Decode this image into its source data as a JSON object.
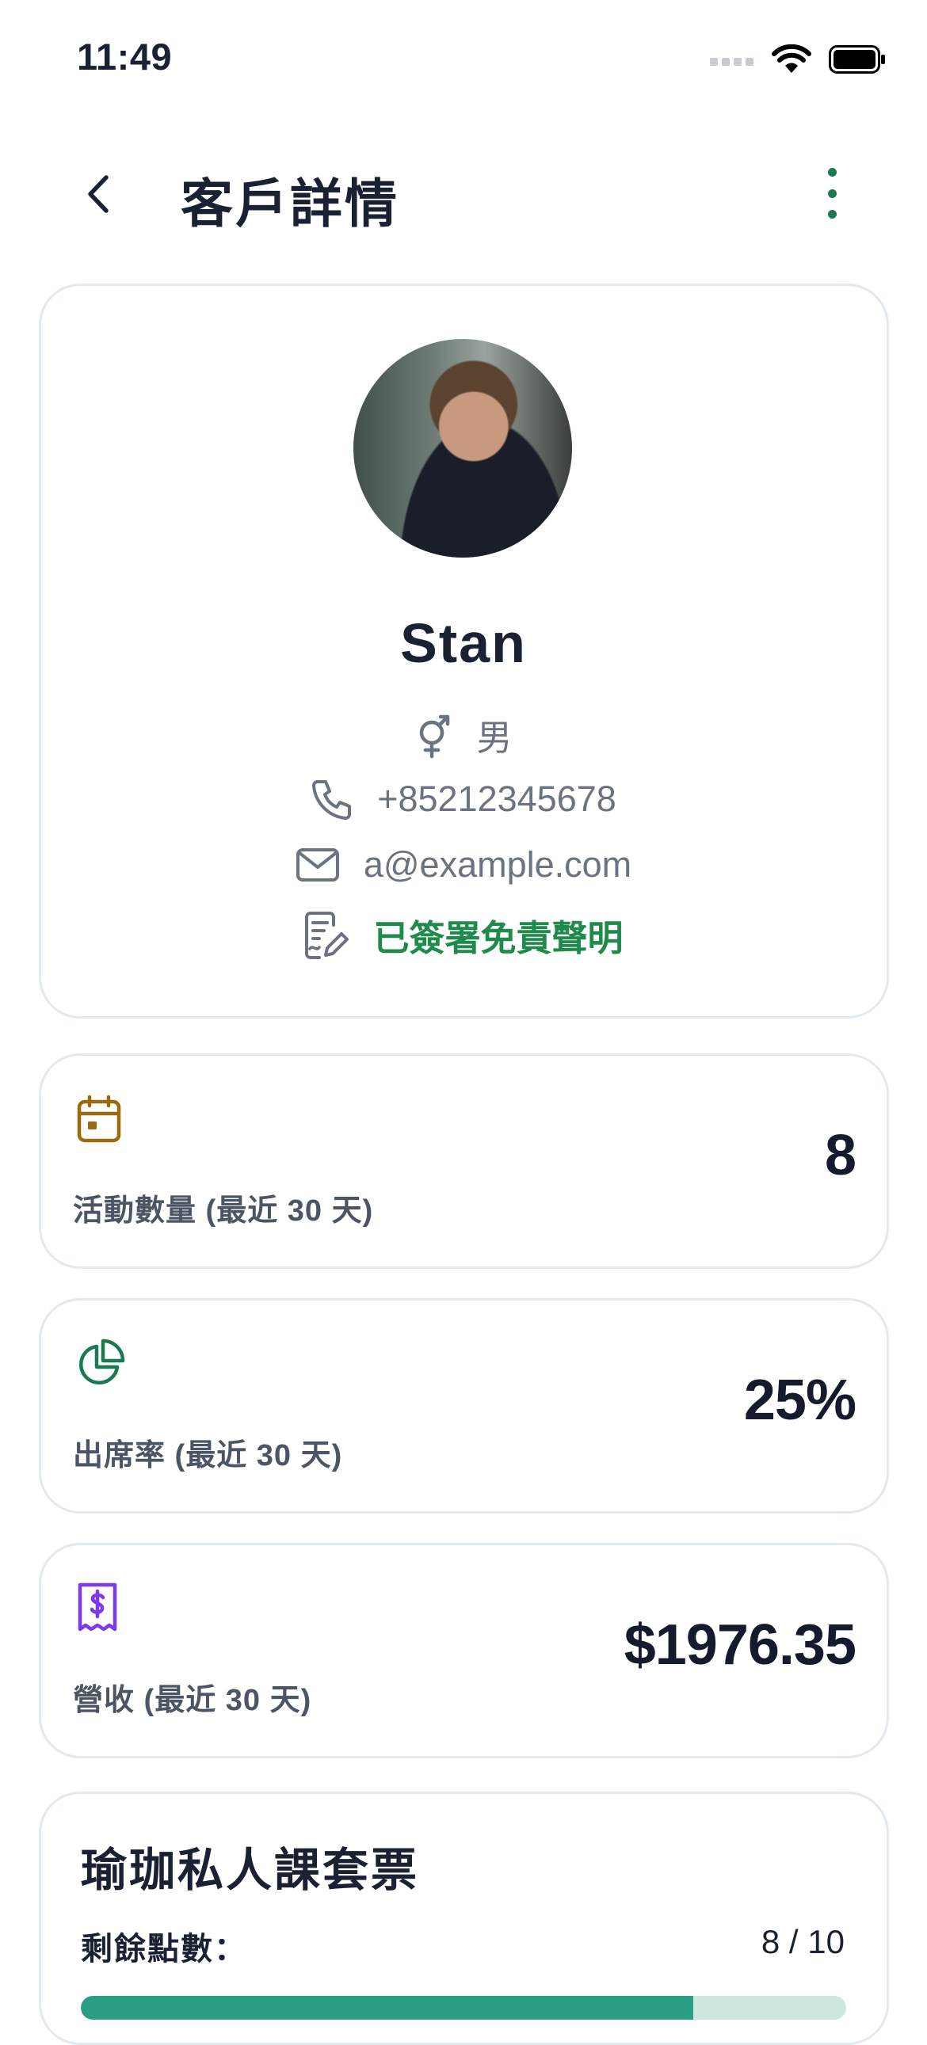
{
  "status_bar": {
    "time": "11:49"
  },
  "header": {
    "title": "客戶詳情"
  },
  "profile": {
    "name": "Stan",
    "gender": "男",
    "phone": "+85212345678",
    "email": "a@example.com",
    "waiver_status": "已簽署免責聲明"
  },
  "stats": [
    {
      "icon": "calendar-icon",
      "label": "活動數量 (最近 30 天)",
      "value": "8",
      "color": "#9a6a12"
    },
    {
      "icon": "pie-chart-icon",
      "label": "出席率 (最近 30 天)",
      "value": "25%",
      "color": "#1b7a4f"
    },
    {
      "icon": "receipt-icon",
      "label": "營收 (最近 30 天)",
      "value": "$1976.35",
      "color": "#7c3aed"
    }
  ],
  "package": {
    "title": "瑜珈私人課套票",
    "remaining_label": "剩餘點數：",
    "remaining_value": "8 / 10",
    "progress": 0.8
  },
  "colors": {
    "accent": "#1b7a4f",
    "waiver": "#1f8a4c",
    "progress_fill": "#2a9e83",
    "progress_track": "#cde7de"
  }
}
